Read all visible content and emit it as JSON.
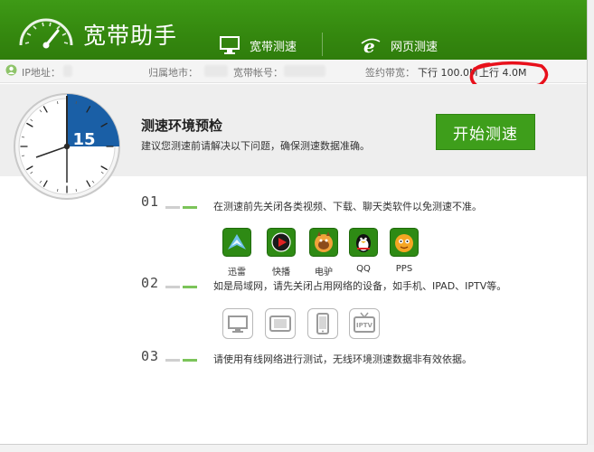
{
  "app": {
    "title": "宽带助手"
  },
  "tabs": [
    {
      "label": "宽带测速",
      "icon": "monitor-icon"
    },
    {
      "label": "网页测速",
      "icon": "ie-browser-icon"
    }
  ],
  "infobar": {
    "ip_label": "IP地址：",
    "location_label": "归属地市：",
    "account_label": "宽带帐号：",
    "bandwidth_label": "签约带宽：",
    "download": "下行 100.0M",
    "upload": "上行 4.0M"
  },
  "timer": {
    "value": "15"
  },
  "check": {
    "title": "测速环境预检",
    "description": "建议您测速前请解决以下问题，确保测速数据准确。",
    "start_button": "开始测速"
  },
  "steps": [
    {
      "number": "01",
      "text": "在测速前先关闭各类视频、下载、聊天类软件以免测速不准。"
    },
    {
      "number": "02",
      "text": "如是局域网，请先关闭占用网络的设备，如手机、IPAD、IPTV等。"
    },
    {
      "number": "03",
      "text": "请使用有线网络进行测试，无线环境测速数据非有效依据。"
    }
  ],
  "apps": [
    {
      "label": "迅雷",
      "icon": "xunlei-bird-icon"
    },
    {
      "label": "快播",
      "icon": "qvod-player-icon"
    },
    {
      "label": "电驴",
      "icon": "emule-donkey-icon"
    },
    {
      "label": "QQ",
      "icon": "qq-penguin-icon"
    },
    {
      "label": "PPS",
      "icon": "pps-icon"
    }
  ],
  "devices": [
    {
      "icon": "desktop-icon"
    },
    {
      "icon": "tablet-icon"
    },
    {
      "icon": "phone-icon"
    },
    {
      "icon": "iptv-icon",
      "label": "IPTV"
    }
  ],
  "colors": {
    "header_green": "#35890f",
    "button_green": "#3e9e1b",
    "clock_blue": "#1a5fa6",
    "annotation_red": "#e8101b"
  }
}
